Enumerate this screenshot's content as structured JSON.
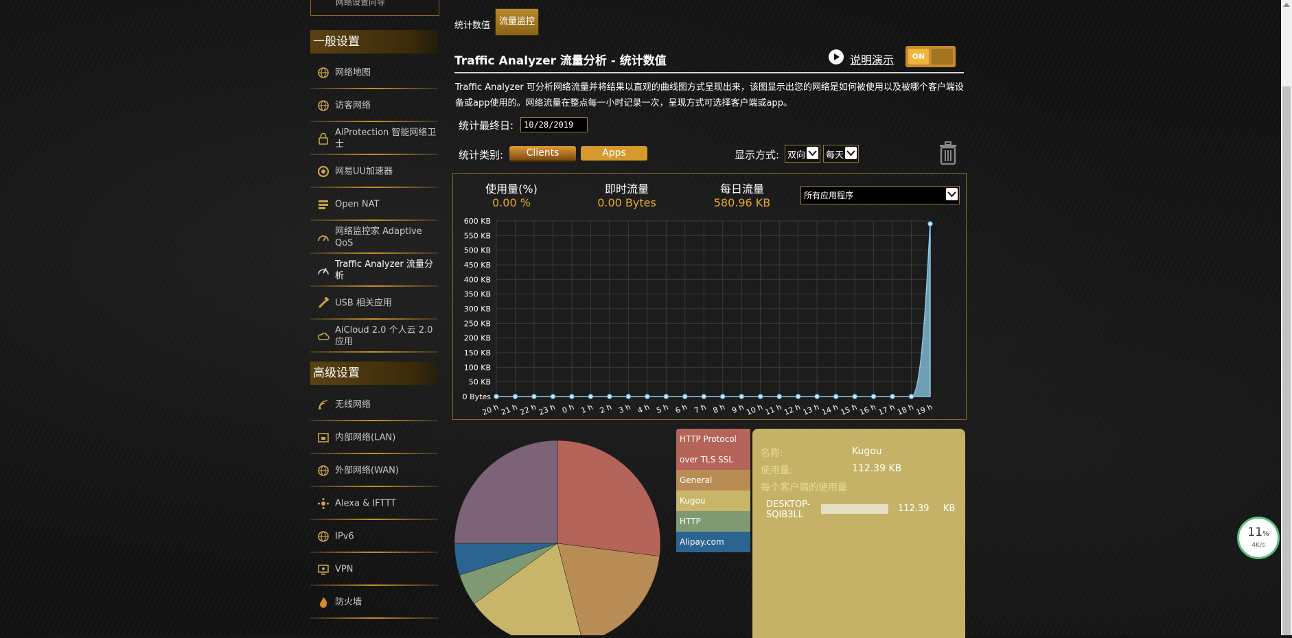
{
  "sidebar": {
    "top_item_label": "网络设置向导",
    "section_general": "一般设置",
    "general_items": [
      {
        "label": "网络地图",
        "icon": "globe-icon"
      },
      {
        "label": "访客网络",
        "icon": "globe-icon"
      },
      {
        "label": "AiProtection 智能网络卫士",
        "icon": "lock-icon"
      },
      {
        "label": "网易UU加速器",
        "icon": "speed-ring-icon"
      },
      {
        "label": "Open NAT",
        "icon": "nat-icon"
      },
      {
        "label": "网络监控家 Adaptive QoS",
        "icon": "gauge-icon"
      },
      {
        "label": "Traffic Analyzer 流量分析",
        "icon": "chart-icon"
      },
      {
        "label": "USB 相关应用",
        "icon": "usb-icon"
      },
      {
        "label": "AiCloud 2.0 个人云 2.0 应用",
        "icon": "cloud-icon"
      }
    ],
    "section_advanced": "高级设置",
    "advanced_items": [
      {
        "label": "无线网络",
        "icon": "wifi-icon"
      },
      {
        "label": "内部网络(LAN)",
        "icon": "lan-icon"
      },
      {
        "label": "外部网络(WAN)",
        "icon": "globe-icon"
      },
      {
        "label": "Alexa & IFTTT",
        "icon": "alexa-icon"
      },
      {
        "label": "IPv6",
        "icon": "globe-icon"
      },
      {
        "label": "VPN",
        "icon": "vpn-icon"
      },
      {
        "label": "防火墙",
        "icon": "fire-icon"
      }
    ]
  },
  "tabs": {
    "stats": "统计数值",
    "monitor": "流量监控"
  },
  "header": {
    "title": "Traffic Analyzer 流量分析 - 统计数值",
    "demo_link": "说明演示",
    "toggle_label": "ON"
  },
  "description": "Traffic Analyzer 可分析网络流量并将结果以直观的曲线图方式呈现出来，该图显示出您的网络是如何被使用以及被哪个客户端设备或app使用的。网络流量在整点每一小时记录一次，呈现方式可选择客户端或app。",
  "controls": {
    "end_date_label": "统计最终日:",
    "end_date_value": "10/28/2019",
    "category_label": "统计类别:",
    "btn_clients": "Clients",
    "btn_apps": "Apps",
    "display_label": "显示方式:",
    "direction_value": "双向",
    "period_value": "每天"
  },
  "stats": {
    "usage_label": "使用量(%)",
    "usage_value": "0.00 %",
    "instant_label": "即时流量",
    "instant_value": "0.00 Bytes",
    "daily_label": "每日流量",
    "daily_value": "580.96 KB",
    "app_filter": "所有应用程序"
  },
  "colors": {
    "accent": "#e9a72a",
    "line": "#8ec8e8",
    "detail_bg": "#c6b267"
  },
  "chart_data": {
    "type": "area",
    "y_unit": "KB",
    "ylim": [
      0,
      600
    ],
    "y_ticks": [
      "0 Bytes",
      "50 KB",
      "100 KB",
      "150 KB",
      "200 KB",
      "250 KB",
      "300 KB",
      "350 KB",
      "400 KB",
      "450 KB",
      "500 KB",
      "550 KB",
      "600 KB"
    ],
    "x": [
      "20 h",
      "21 h",
      "22 h",
      "23 h",
      "0 h",
      "1 h",
      "2 h",
      "3 h",
      "4 h",
      "5 h",
      "6 h",
      "7 h",
      "8 h",
      "9 h",
      "10 h",
      "11 h",
      "12 h",
      "13 h",
      "14 h",
      "15 h",
      "16 h",
      "17 h",
      "18 h",
      "19 h"
    ],
    "values": [
      0,
      0,
      0,
      0,
      0,
      0,
      0,
      0,
      0,
      0,
      0,
      0,
      0,
      0,
      0,
      0,
      0,
      0,
      0,
      0,
      0,
      0,
      0,
      590
    ],
    "grid": true
  },
  "pie": {
    "type": "pie",
    "slices": [
      {
        "name": "HTTP Protocol over TLS SSL",
        "value": 27,
        "color": "#b5645a"
      },
      {
        "name": "General",
        "value": 19,
        "color": "#b98c56"
      },
      {
        "name": "Kugou",
        "value": 19,
        "color": "#c9b56a"
      },
      {
        "name": "HTTP",
        "value": 5,
        "color": "#7f9a72"
      },
      {
        "name": "Alipay.com",
        "value": 5,
        "color": "#2c6491"
      },
      {
        "name": "",
        "value": 25,
        "color": "#7c6377"
      }
    ]
  },
  "legend": [
    {
      "label": "HTTP Protocol",
      "color": "#b5645a"
    },
    {
      "label": "over TLS SSL",
      "color": "#b5645a"
    },
    {
      "label": "General",
      "color": "#b98c56"
    },
    {
      "label": "Kugou",
      "color": "#c9b56a"
    },
    {
      "label": "HTTP",
      "color": "#7f9a72"
    },
    {
      "label": "Alipay.com",
      "color": "#2c6491"
    }
  ],
  "detail": {
    "name_key": "名称:",
    "name_value": "Kugou",
    "usage_key": "使用量:",
    "usage_value": "112.39 KB",
    "clients_key": "每个客户端的使用量",
    "client_name": "DESKTOP-SQIB3LL",
    "client_value": "112.39",
    "client_unit": "KB",
    "client_fraction": 1
  },
  "cpu_widget": {
    "percent": "11",
    "unit": "%",
    "speed": "4K/s"
  }
}
